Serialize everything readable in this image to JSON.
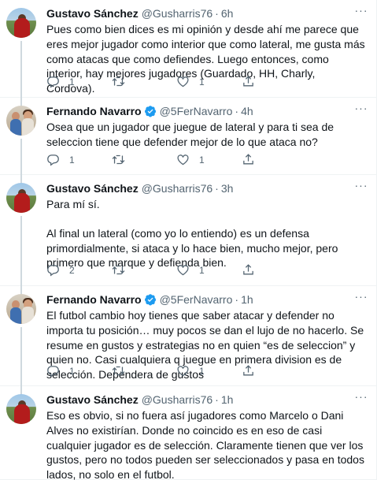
{
  "tweets": [
    {
      "name": "Gustavo Sánchez",
      "handle": "@Gusharris76",
      "time": "6h",
      "verified": false,
      "avatar": "gustavo",
      "paragraphs": [
        "Pues como bien dices es mi opinión y desde ahí me parece que eres mejor jugador como interior que como lateral, me gusta más como atacas que como defiendes. Luego entonces, como interior, hay mejores jugadores (Guardado, HH, Charly, Cordova)."
      ],
      "replies": "1",
      "retweets": "",
      "likes": "1"
    },
    {
      "name": "Fernando Navarro",
      "handle": "@5FerNavarro",
      "time": "4h",
      "verified": true,
      "avatar": "fernando",
      "paragraphs": [
        "Osea que un jugador que juegue de lateral y para ti sea de seleccion tiene que defender mejor de lo que ataca no?"
      ],
      "replies": "1",
      "retweets": "",
      "likes": "1"
    },
    {
      "name": "Gustavo Sánchez",
      "handle": "@Gusharris76",
      "time": "3h",
      "verified": false,
      "avatar": "gustavo",
      "paragraphs": [
        "Para mí sí.",
        "Al final un lateral (como yo lo entiendo) es un defensa primordialmente, si ataca y lo hace bien, mucho mejor, pero primero que marque y defienda bien."
      ],
      "replies": "2",
      "retweets": "",
      "likes": "1"
    },
    {
      "name": "Fernando Navarro",
      "handle": "@5FerNavarro",
      "time": "1h",
      "verified": true,
      "avatar": "fernando",
      "paragraphs": [
        "El futbol cambio hoy tienes que saber atacar y defender no importa tu posición… muy pocos se dan el lujo de no hacerlo. Se resume en gustos y estrategias no en quien “es de seleccion” y quien no. Casi cualquiera q juegue en primera division es de selección. Dependera de gustos"
      ],
      "replies": "1",
      "retweets": "",
      "likes": "1"
    },
    {
      "name": "Gustavo Sánchez",
      "handle": "@Gusharris76",
      "time": "1h",
      "verified": false,
      "avatar": "gustavo",
      "paragraphs": [
        "Eso es obvio, si no fuera así jugadores como Marcelo o Dani Alves no existirían. Donde no coincido es en eso de casi cualquier jugador es de selección. Claramente tienen que ver los gustos, pero no todos pueden ser seleccionados y pasa en todos lados, no solo en el futbol."
      ],
      "replies": "",
      "retweets": "",
      "likes": ""
    }
  ],
  "icons": {
    "reply": "reply-icon",
    "retweet": "retweet-icon",
    "like": "heart-icon",
    "share": "share-icon",
    "more": "more-icon",
    "verified": "verified-badge-icon"
  },
  "colors": {
    "text": "#0f1419",
    "secondary": "#536471",
    "verified": "#1d9bf0",
    "divider": "#eff3f4"
  }
}
